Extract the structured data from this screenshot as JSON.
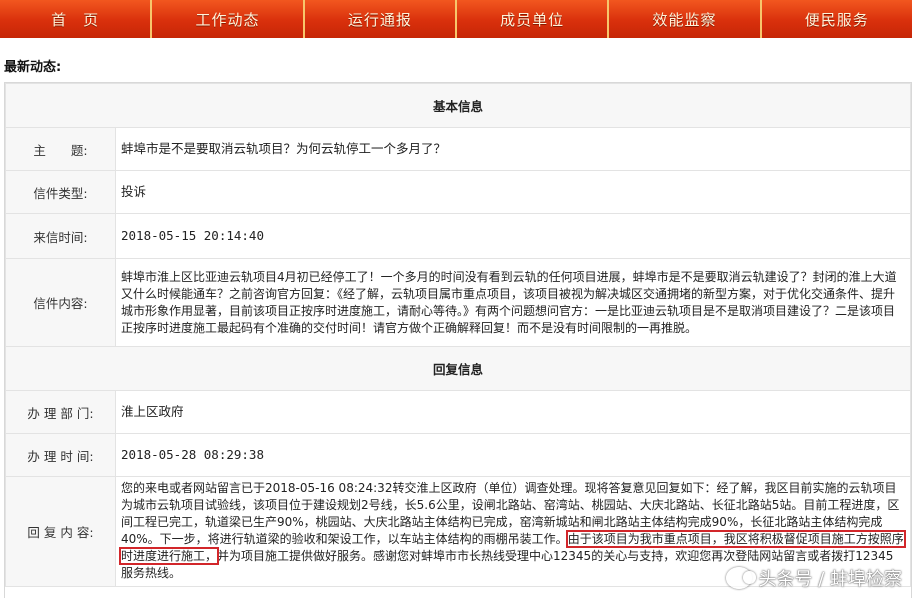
{
  "nav": {
    "items": [
      "首　页",
      "工作动态",
      "运行通报",
      "成员单位",
      "效能监察",
      "便民服务"
    ],
    "color": "#d9300c"
  },
  "latest_label": "最新动态:",
  "basic": {
    "header": "基本信息",
    "subject_label": "主　　题:",
    "subject": "蚌埠市是不是要取消云轨项目？为何云轨停工一个多月了？",
    "type_label": "信件类型:",
    "type": "投诉",
    "time_label": "来信时间:",
    "time": "2018-05-15 20:14:40",
    "content_label": "信件内容:",
    "content": "蚌埠市淮上区比亚迪云轨项目4月初已经停工了！一个多月的时间没有看到云轨的任何项目进展，蚌埠市是不是要取消云轨建设了？封闭的淮上大道又什么时候能通车？之前咨询官方回复：《经了解，云轨项目属市重点项目，该项目被视为解决城区交通拥堵的新型方案，对于优化交通条件、提升城市形象作用显著，目前该项目正按序时进度施工，请耐心等待。》有两个问题想问官方：一是比亚迪云轨项目是不是取消项目建设了？二是该项目正按序时进度施工最起码有个准确的交付时间！请官方做个正确解释回复！而不是没有时间限制的一再推脱。"
  },
  "reply": {
    "header": "回复信息",
    "dept_label": "办 理 部 门:",
    "dept": "淮上区政府",
    "time_label": "办 理 时 间:",
    "time": "2018-05-28 08:29:38",
    "content_label": "回 复 内 容:",
    "content_before": "您的来电或者网站留言已于2018-05-16 08:24:32转交淮上区政府（单位）调查处理。现将答复意见回复如下：经了解，我区目前实施的云轨项目为城市云轨项目试验线，该项目位于建设规划2号线，长5.6公里，设闸北路站、窑湾站、桃园站、大庆北路站、长征北路站5站。目前工程进度，区间工程已完工，轨道梁已生产90%，桃园站、大庆北路站主体结构已完成，窑湾新城站和闸北路站主体结构完成90%，长征北路站主体结构完成40%。下一步，将进行轨道梁的验收和架设工作，以车站主体结构的雨棚吊装工作。",
    "content_highlight": "由于该项目为我市重点项目，我区将积极督促项目施工方按照序时进度进行施工，",
    "content_after": "并为项目施工提供做好服务。感谢您对蚌埠市市长热线受理中心12345的关心与支持，欢迎您再次登陆网站留言或者拨打12345服务热线。"
  },
  "watermark": "头条号 / 蚌埠检察"
}
